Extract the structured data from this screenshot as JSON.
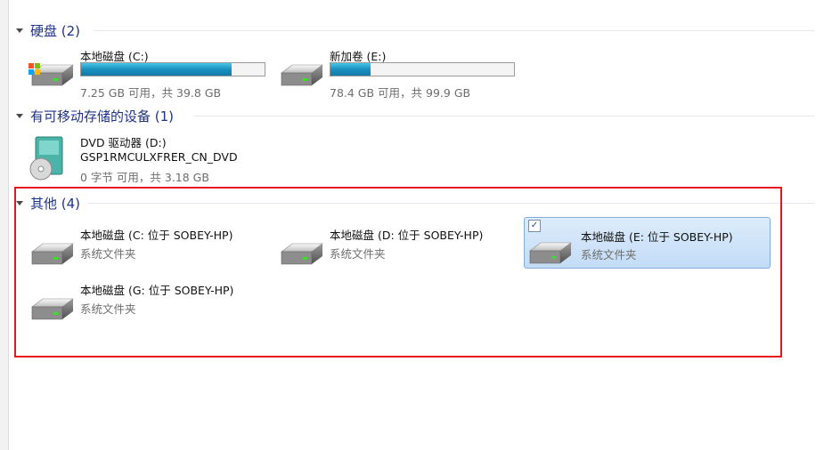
{
  "groups": {
    "hdd": {
      "title": "硬盘 (2)"
    },
    "removable": {
      "title": "有可移动存储的设备 (1)"
    },
    "other": {
      "title": "其他 (4)"
    }
  },
  "hdd_items": [
    {
      "name": "本地磁盘 (C:)",
      "space": "7.25 GB 可用，共 39.8 GB",
      "used_fraction": 0.82,
      "icon": "windows-drive-icon"
    },
    {
      "name": "新加卷 (E:)",
      "space": "78.4 GB 可用，共 99.9 GB",
      "used_fraction": 0.22,
      "icon": "hard-drive-icon"
    }
  ],
  "removable_items": [
    {
      "name": "DVD 驱动器 (D:)",
      "label": "GSP1RMCULXFRER_CN_DVD",
      "space": "0 字节 可用，共 3.18 GB",
      "icon": "dvd-drive-icon"
    }
  ],
  "other_items": [
    {
      "name": "本地磁盘 (C: 位于 SOBEY-HP)",
      "type": "系统文件夹",
      "icon": "network-drive-icon"
    },
    {
      "name": "本地磁盘 (D: 位于 SOBEY-HP)",
      "type": "系统文件夹",
      "icon": "network-drive-icon"
    },
    {
      "name": "本地磁盘 (E: 位于 SOBEY-HP)",
      "type": "系统文件夹",
      "icon": "network-drive-icon",
      "selected": true,
      "checked": true
    },
    {
      "name": "本地磁盘 (G: 位于 SOBEY-HP)",
      "type": "系统文件夹",
      "icon": "network-drive-icon"
    }
  ],
  "colors": {
    "accent": "#1e3287",
    "highlight": "#e8151b",
    "bar_fill": "#1a8fbe",
    "selection": "#cfe3f9"
  }
}
